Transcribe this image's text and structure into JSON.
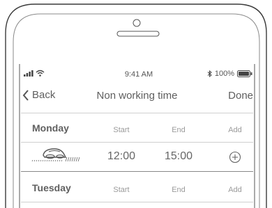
{
  "status_bar": {
    "time": "9:41 AM",
    "battery": "100%"
  },
  "nav": {
    "back_label": "Back",
    "title": "Non working time",
    "done_label": "Done"
  },
  "days": [
    {
      "day": "Monday",
      "col_start": "Start",
      "col_end": "End",
      "col_add": "Add"
    },
    {
      "day": "Tuesday",
      "col_start": "Start",
      "col_end": "End",
      "col_add": "Add"
    }
  ],
  "entries": [
    {
      "start": "12:00",
      "end": "15:00"
    }
  ]
}
